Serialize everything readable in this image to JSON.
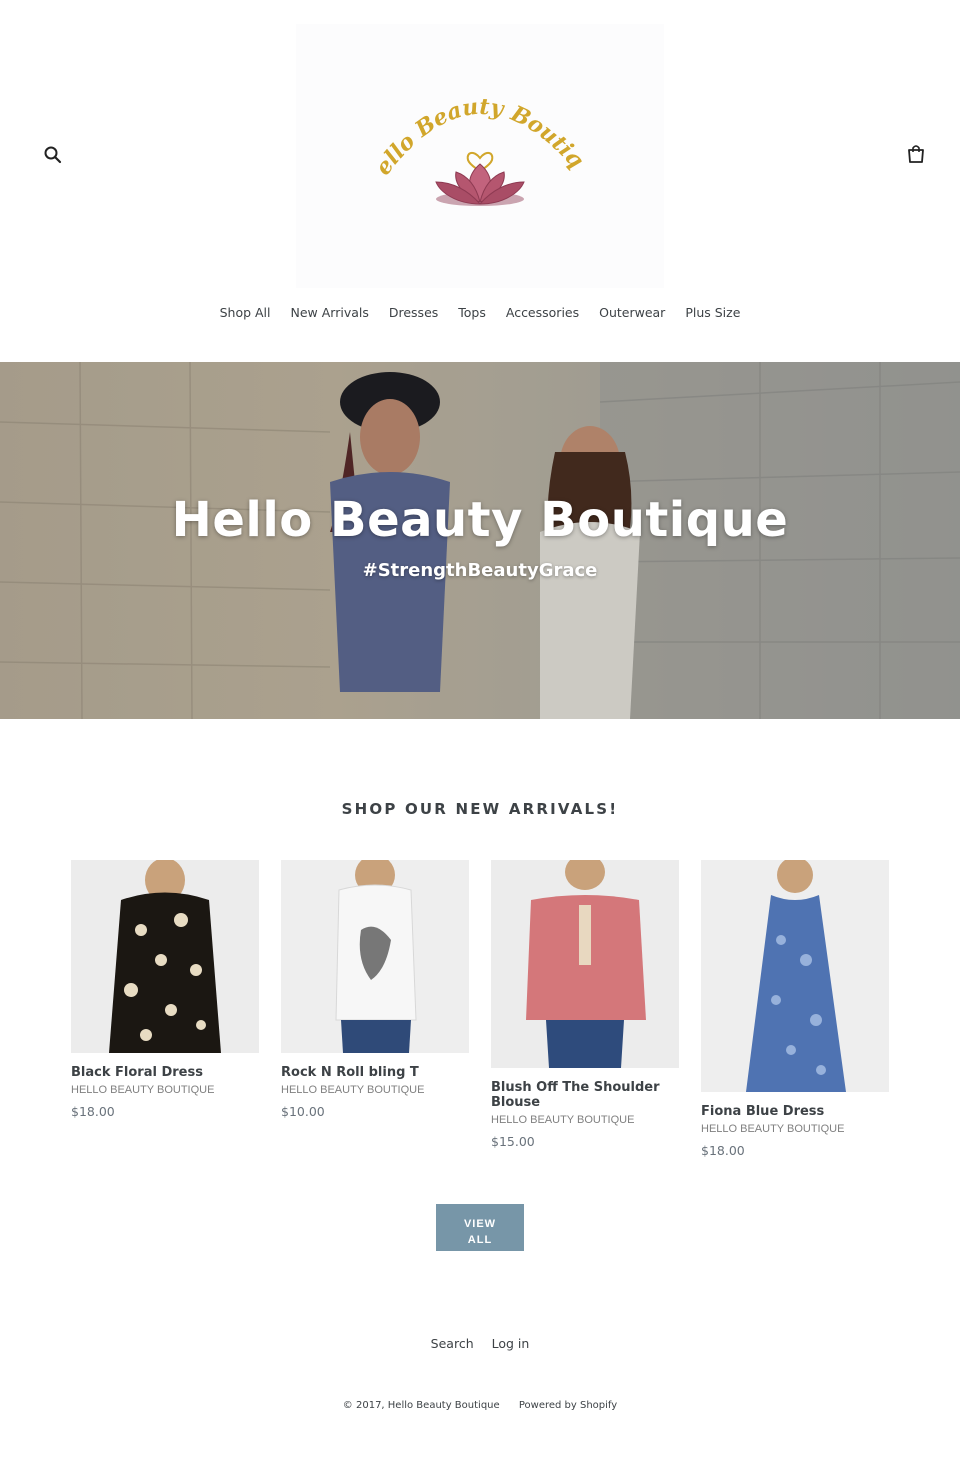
{
  "header": {
    "logo_text": "Hello Beauty Boutique",
    "search_icon": "search-icon",
    "cart_icon": "cart-icon"
  },
  "nav": {
    "items": [
      {
        "label": "Shop All"
      },
      {
        "label": "New Arrivals"
      },
      {
        "label": "Dresses"
      },
      {
        "label": "Tops"
      },
      {
        "label": "Accessories"
      },
      {
        "label": "Outerwear"
      },
      {
        "label": "Plus Size"
      }
    ]
  },
  "hero": {
    "title": "Hello Beauty Boutique",
    "subtitle": "#StrengthBeautyGrace"
  },
  "section": {
    "title": "SHOP OUR NEW ARRIVALS!"
  },
  "products": [
    {
      "name": "Black Floral Dress",
      "vendor": "HELLO BEAUTY BOUTIQUE",
      "price": "$18.00"
    },
    {
      "name": "Rock N Roll bling T",
      "vendor": "HELLO BEAUTY BOUTIQUE",
      "price": "$10.00"
    },
    {
      "name": "Blush Off The Shoulder Blouse",
      "vendor": "HELLO BEAUTY BOUTIQUE",
      "price": "$15.00"
    },
    {
      "name": "Fiona Blue Dress",
      "vendor": "HELLO BEAUTY BOUTIQUE",
      "price": "$18.00"
    }
  ],
  "view_all": {
    "line1": "VIEW",
    "line2": "ALL"
  },
  "footer": {
    "links": [
      {
        "label": "Search"
      },
      {
        "label": "Log in"
      }
    ],
    "copyright": "© 2017, Hello Beauty Boutique",
    "powered": "Powered by Shopify"
  },
  "colors": {
    "accent": "#7796a8",
    "text": "#3d4246",
    "logo_gold": "#d1a62b",
    "lotus": "#b5566f"
  }
}
